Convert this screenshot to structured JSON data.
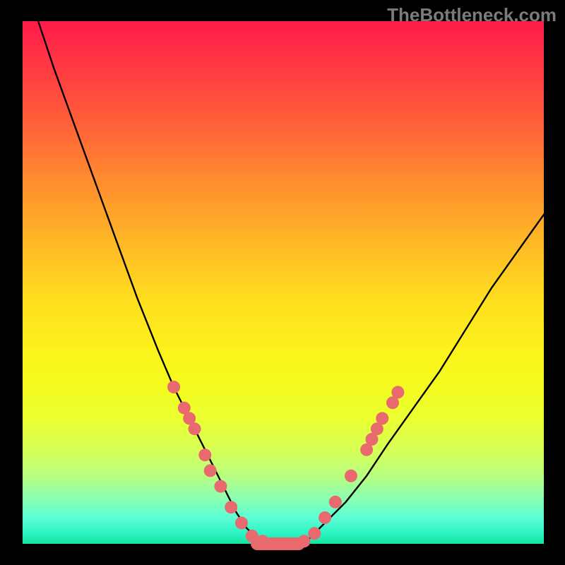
{
  "watermark": "TheBottleneck.com",
  "chart_data": {
    "type": "line",
    "title": "",
    "xlabel": "",
    "ylabel": "",
    "xlim": [
      0,
      100
    ],
    "ylim": [
      0,
      100
    ],
    "grid": false,
    "legend": false,
    "series": [
      {
        "name": "bottleneck-curve",
        "x": [
          3,
          6,
          10,
          14,
          18,
          22,
          26,
          29,
          31,
          33,
          35,
          37,
          39,
          41,
          43,
          45,
          47,
          49,
          52,
          55,
          58,
          62,
          66,
          70,
          75,
          80,
          85,
          90,
          95,
          100
        ],
        "y": [
          100,
          91,
          80,
          69,
          58,
          47,
          37,
          30,
          26,
          22,
          18,
          14,
          10,
          6,
          3,
          1,
          0,
          0,
          0,
          1,
          4,
          8,
          13,
          19,
          26,
          33,
          41,
          49,
          56,
          63
        ]
      }
    ],
    "markers": [
      {
        "x": 29,
        "y": 30
      },
      {
        "x": 31,
        "y": 26
      },
      {
        "x": 32,
        "y": 24
      },
      {
        "x": 33,
        "y": 22
      },
      {
        "x": 35,
        "y": 17
      },
      {
        "x": 36,
        "y": 14
      },
      {
        "x": 38,
        "y": 11
      },
      {
        "x": 40,
        "y": 7
      },
      {
        "x": 42,
        "y": 4
      },
      {
        "x": 44,
        "y": 1.5
      },
      {
        "x": 46,
        "y": 0.5
      },
      {
        "x": 48,
        "y": 0
      },
      {
        "x": 50,
        "y": 0
      },
      {
        "x": 52,
        "y": 0
      },
      {
        "x": 54,
        "y": 0.5
      },
      {
        "x": 56,
        "y": 2
      },
      {
        "x": 58,
        "y": 5
      },
      {
        "x": 60,
        "y": 8
      },
      {
        "x": 63,
        "y": 13
      },
      {
        "x": 66,
        "y": 18
      },
      {
        "x": 67,
        "y": 20
      },
      {
        "x": 68,
        "y": 22
      },
      {
        "x": 69,
        "y": 24
      },
      {
        "x": 71,
        "y": 27
      },
      {
        "x": 72,
        "y": 29
      }
    ],
    "marker_radius": 9,
    "marker_color": "#e86a6f",
    "flat_bottom": {
      "x_start": 45,
      "x_end": 53,
      "y": 0,
      "stroke_width": 18
    },
    "background_gradient": {
      "top": "#ff1b4a",
      "mid": "#fef41f",
      "bottom": "#14e59d"
    }
  }
}
